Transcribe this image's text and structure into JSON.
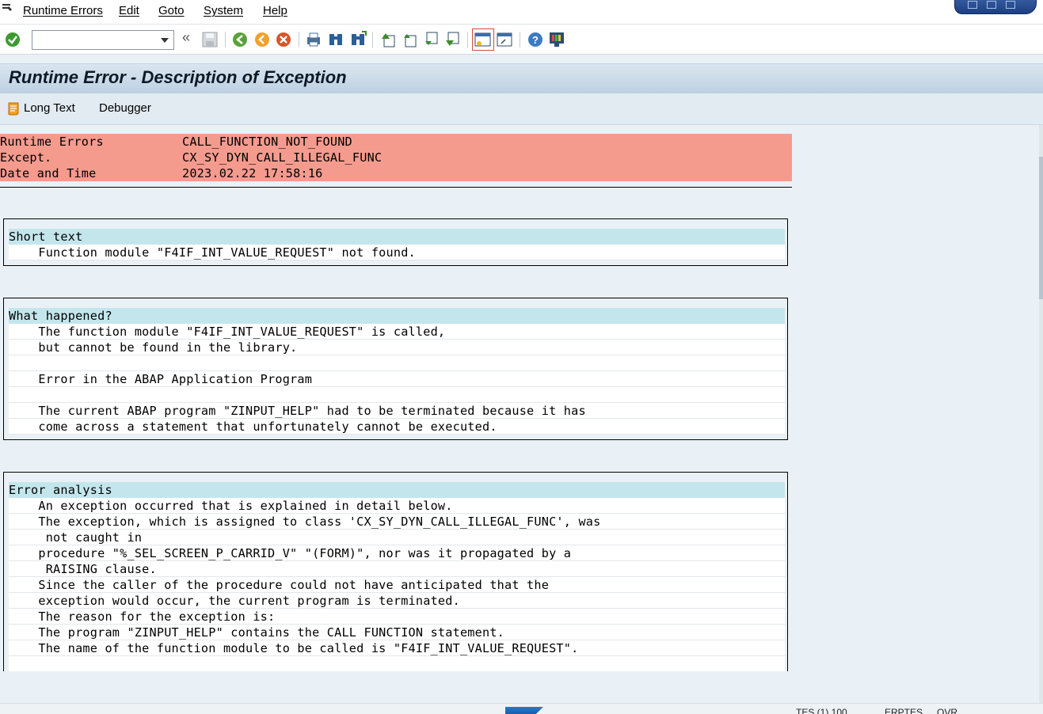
{
  "menubar": {
    "items": [
      "Runtime Errors",
      "Edit",
      "Goto",
      "System",
      "Help"
    ]
  },
  "toolbar": {
    "command_field_value": "",
    "icons": [
      "enter-icon",
      "back-icon",
      "save-icon",
      "back-green-icon",
      "exit-icon",
      "cancel-icon",
      "print-icon",
      "find-icon",
      "find-next-icon",
      "first-page-icon",
      "previous-page-icon",
      "next-page-icon",
      "last-page-icon",
      "create-session-icon",
      "shortcut-icon",
      "help-icon",
      "customize-layout-icon"
    ]
  },
  "title": "Runtime Error - Description of Exception",
  "app_toolbar": {
    "long_text": "Long Text",
    "debugger": "Debugger"
  },
  "header_rows": [
    {
      "key": "Runtime Errors",
      "value": "CALL_FUNCTION_NOT_FOUND"
    },
    {
      "key": "Except.",
      "value": "CX_SY_DYN_CALL_ILLEGAL_FUNC"
    },
    {
      "key": "Date and Time",
      "value": "2023.02.22 17:58:16"
    }
  ],
  "sections": [
    {
      "heading": "Short text",
      "lines": [
        "    Function module \"F4IF_INT_VALUE_REQUEST\" not found."
      ]
    },
    {
      "heading": "What happened?",
      "lines": [
        "    The function module \"F4IF_INT_VALUE_REQUEST\" is called,",
        "    but cannot be found in the library.",
        "",
        "    Error in the ABAP Application Program",
        "",
        "    The current ABAP program \"ZINPUT_HELP\" had to be terminated because it has",
        "    come across a statement that unfortunately cannot be executed."
      ]
    },
    {
      "heading": "Error analysis",
      "lines": [
        "    An exception occurred that is explained in detail below.",
        "    The exception, which is assigned to class 'CX_SY_DYN_CALL_ILLEGAL_FUNC', was",
        "     not caught in",
        "    procedure \"%_SEL_SCREEN_P_CARRID_V\" \"(FORM)\", nor was it propagated by a",
        "     RAISING clause.",
        "    Since the caller of the procedure could not have anticipated that the",
        "    exception would occur, the current program is terminated.",
        "    The reason for the exception is:",
        "    The program \"ZINPUT_HELP\" contains the CALL FUNCTION statement.",
        "    The name of the function module to be called is \"F4IF_INT_VALUE_REQUEST\".",
        ""
      ]
    }
  ],
  "statusbar": {
    "system": "TES (1) 100",
    "server": "ERPTES",
    "mode": "OVR"
  },
  "colors": {
    "header_rows": "#f59b8e",
    "section_heading": "#c3e6ec",
    "background": "#eaf1f6"
  }
}
